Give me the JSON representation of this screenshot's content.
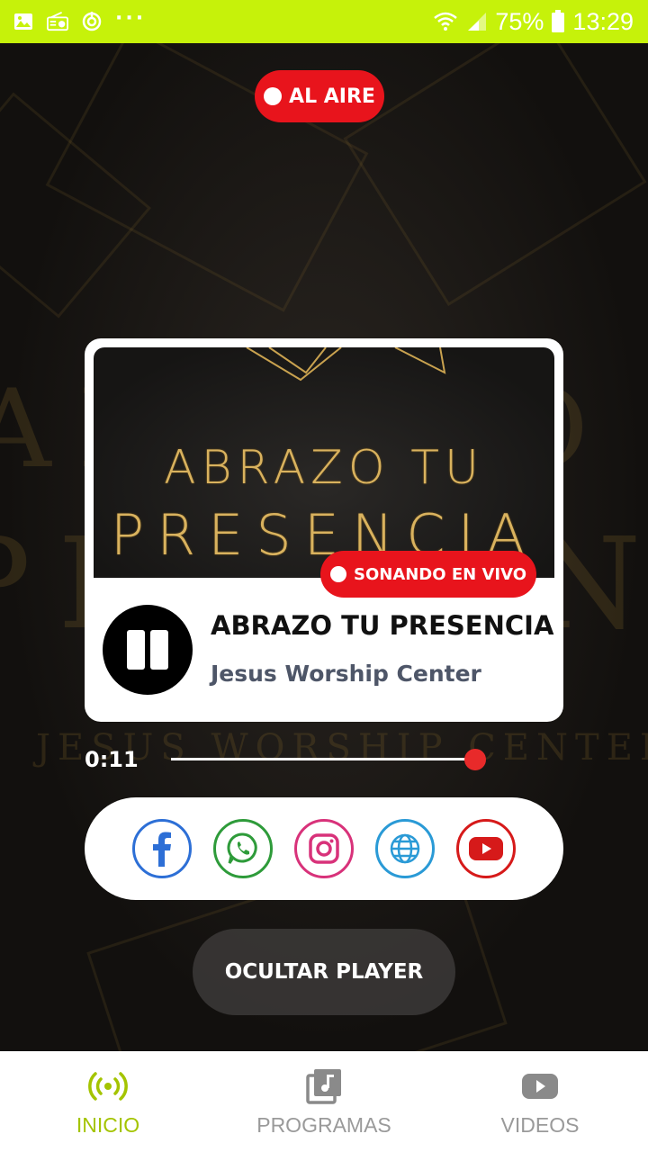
{
  "status_bar": {
    "battery_pct": "75%",
    "time": "13:29",
    "icons": [
      "image-icon",
      "radio-icon",
      "sync-icon",
      "more-dots-icon",
      "wifi-icon",
      "signal-icon",
      "battery-icon"
    ]
  },
  "on_air": {
    "label": "AL AIRE"
  },
  "player": {
    "cover_line1": "ABRAZO TU",
    "cover_line2": "PRESENCIA",
    "live_label": "SONANDO EN VIVO",
    "title": "ABRAZO TU PRESENCIA",
    "artist": "Jesus Worship Center",
    "state": "playing",
    "elapsed": "0:11",
    "progress_fraction": 1.0
  },
  "social": [
    {
      "name": "facebook",
      "color": "#2d6fd6"
    },
    {
      "name": "whatsapp",
      "color": "#2e9b3a"
    },
    {
      "name": "instagram",
      "color": "#d8327a"
    },
    {
      "name": "website",
      "color": "#2a9ad6"
    },
    {
      "name": "youtube",
      "color": "#d61a1a"
    }
  ],
  "hide_player": {
    "label": "OCULTAR PLAYER"
  },
  "nav": [
    {
      "label": "INICIO",
      "icon": "broadcast-icon",
      "active": true
    },
    {
      "label": "PROGRAMAS",
      "icon": "music-library-icon",
      "active": false
    },
    {
      "label": "VIDEOS",
      "icon": "youtube-icon",
      "active": false
    }
  ],
  "colors": {
    "status_bar": "#c6f20a",
    "accent_red": "#e8141c",
    "nav_active": "#a4c400"
  }
}
